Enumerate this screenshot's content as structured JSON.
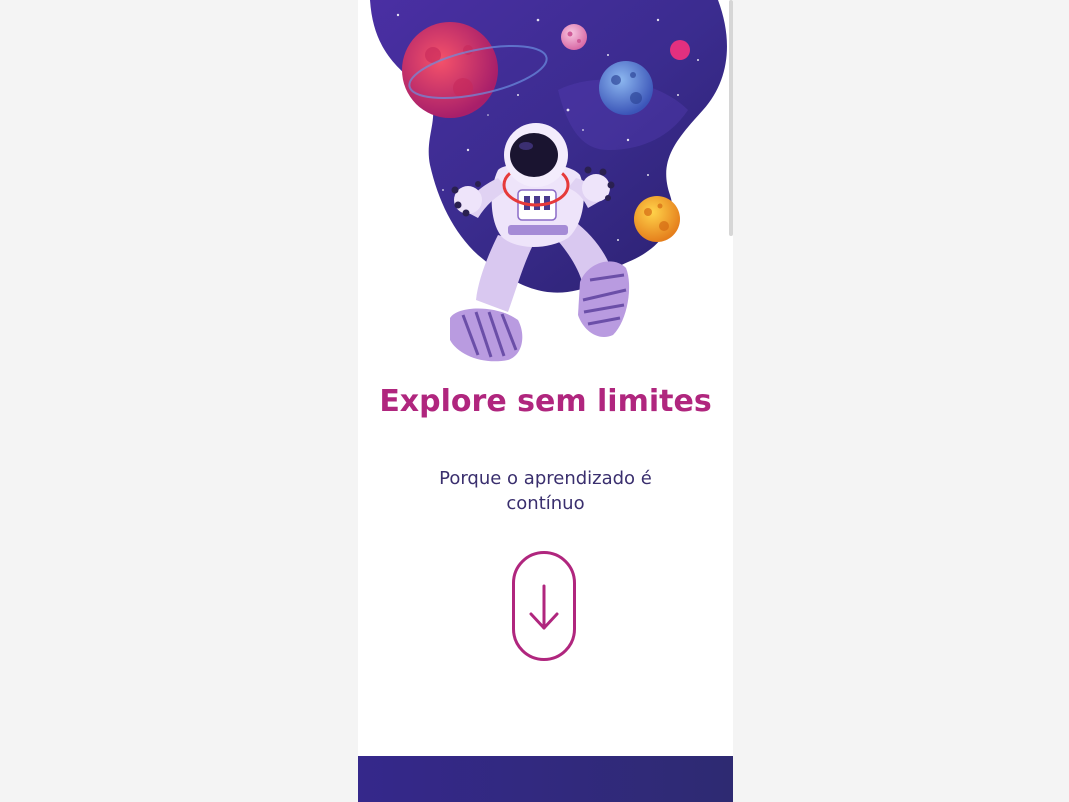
{
  "hero": {
    "illustration": "astronaut-floating-in-space",
    "colors": {
      "space": "#3b2c8f",
      "space_light": "#4d3aa8",
      "planet_red": "#e23a64",
      "planet_blue": "#4a6fd1",
      "planet_orange": "#f2a62c",
      "planet_pink": "#e34f9e",
      "suit": "#e8dcf5"
    }
  },
  "content": {
    "title": "Explore sem limites",
    "subtitle": "Porque o aprendizado é contínuo"
  },
  "scroll_button": {
    "icon": "arrow-down-icon",
    "color": "#b0267e"
  },
  "footer": {
    "color": "#35288b"
  }
}
